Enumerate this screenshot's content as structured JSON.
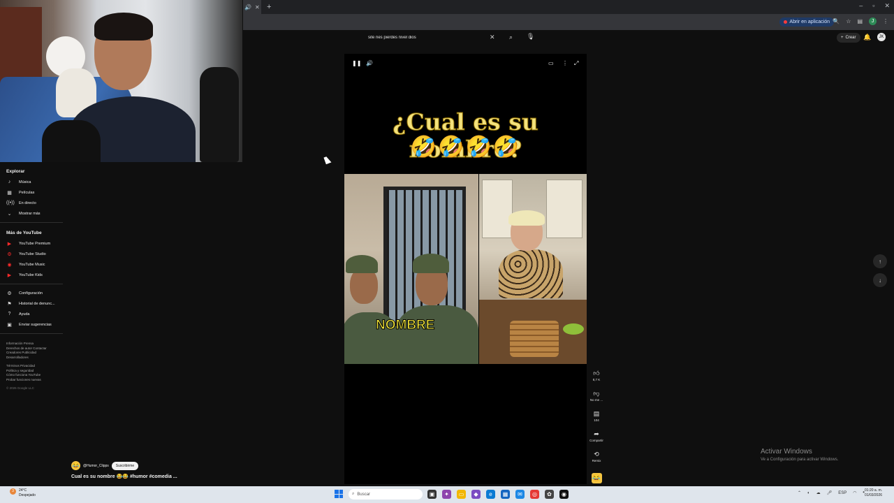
{
  "browser": {
    "tab_icons": [
      "speaker-icon",
      "close-icon"
    ],
    "new_tab": "+",
    "window_controls": [
      "–",
      "▫",
      "✕"
    ],
    "open_in_app": "Abrir en aplicación"
  },
  "youtube": {
    "search_query": "site ries pierdes nivel dios",
    "create_label": "Crear",
    "avatar_letter": "JK"
  },
  "sidebar": {
    "explore_heading": "Explorar",
    "explore_items": [
      {
        "label": "Música",
        "icon": "music-icon"
      },
      {
        "label": "Películas",
        "icon": "film-icon"
      },
      {
        "label": "En directo",
        "icon": "live-icon"
      },
      {
        "label": "Mostrar más",
        "icon": "chevron-down-icon"
      }
    ],
    "more_heading": "Más de YouTube",
    "more_items": [
      {
        "label": "YouTube Premium",
        "icon": "youtube-premium-icon"
      },
      {
        "label": "YouTube Studio",
        "icon": "youtube-studio-icon"
      },
      {
        "label": "YouTube Music",
        "icon": "youtube-music-icon"
      },
      {
        "label": "YouTube Kids",
        "icon": "youtube-kids-icon"
      }
    ],
    "settings_items": [
      {
        "label": "Configuración",
        "icon": "gear-icon"
      },
      {
        "label": "Historial de denunc...",
        "icon": "flag-icon"
      },
      {
        "label": "Ayuda",
        "icon": "help-icon"
      },
      {
        "label": "Enviar sugerencias",
        "icon": "feedback-icon"
      }
    ],
    "footer_line1": "Información  Prensa",
    "footer_line2": "Derechos de autor  Contactar",
    "footer_line3": "Creadores  Publicidad",
    "footer_line4": "Desarrolladores",
    "footer_line5": "Términos  Privacidad",
    "footer_line6": "Política y seguridad",
    "footer_line7": "Cómo funciona YouTube",
    "footer_line8": "Probar funciones nuevas",
    "copyright": "© 2026 Google LLC"
  },
  "video": {
    "title_overlay": "¿Cual es su nombre?",
    "emoji_overlay": "🤣🤣🤣🤣",
    "caption_overlay": "NOMBRE"
  },
  "actions": {
    "likes": "8,7 K",
    "dislike": "No me ...",
    "comments": "104",
    "share": "Compartir",
    "remix": "Remix"
  },
  "channel": {
    "handle": "@Humor_Clipps",
    "subscribe": "Suscribirme",
    "caption": "Cual es su nombre 😂😂 #humor  #comedia   ..."
  },
  "watermark": {
    "title": "Activar Windows",
    "subtitle": "Ve a Configuración para activar Windows."
  },
  "taskbar": {
    "weather_badge": "3",
    "temperature": "24°C",
    "condition": "Despejado",
    "search_placeholder": "Buscar",
    "language": "ESP",
    "time": "01:20 a. m.",
    "date": "01/03/2026"
  }
}
